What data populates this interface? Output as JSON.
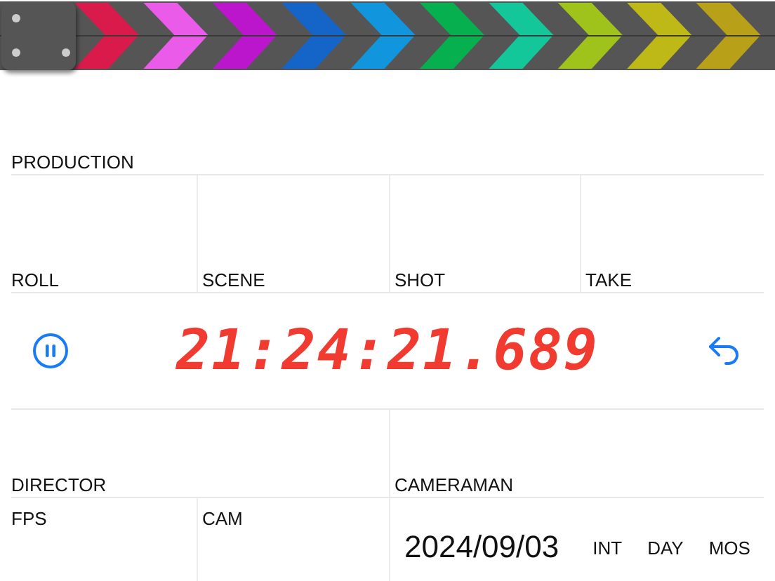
{
  "clapper": {
    "stripes": [
      {
        "color": "#d81b4a"
      },
      {
        "color": "#e95be8"
      },
      {
        "color": "#bb16cc"
      },
      {
        "color": "#1565c8"
      },
      {
        "color": "#1196dd"
      },
      {
        "color": "#06b04f"
      },
      {
        "color": "#14c79a"
      },
      {
        "color": "#9fc31a"
      },
      {
        "color": "#bfb917"
      },
      {
        "color": "#b8a118"
      }
    ]
  },
  "production": {
    "label": "PRODUCTION"
  },
  "fields": [
    {
      "label": "ROLL"
    },
    {
      "label": "SCENE"
    },
    {
      "label": "SHOT"
    },
    {
      "label": "TAKE"
    }
  ],
  "timecode": "21:24:21.689",
  "crew": [
    {
      "label": "DIRECTOR"
    },
    {
      "label": "CAMERAMAN"
    }
  ],
  "camera": [
    {
      "label": "FPS"
    },
    {
      "label": "CAM"
    }
  ],
  "date": "2024/09/03",
  "tags": [
    "INT",
    "DAY",
    "MOS"
  ]
}
